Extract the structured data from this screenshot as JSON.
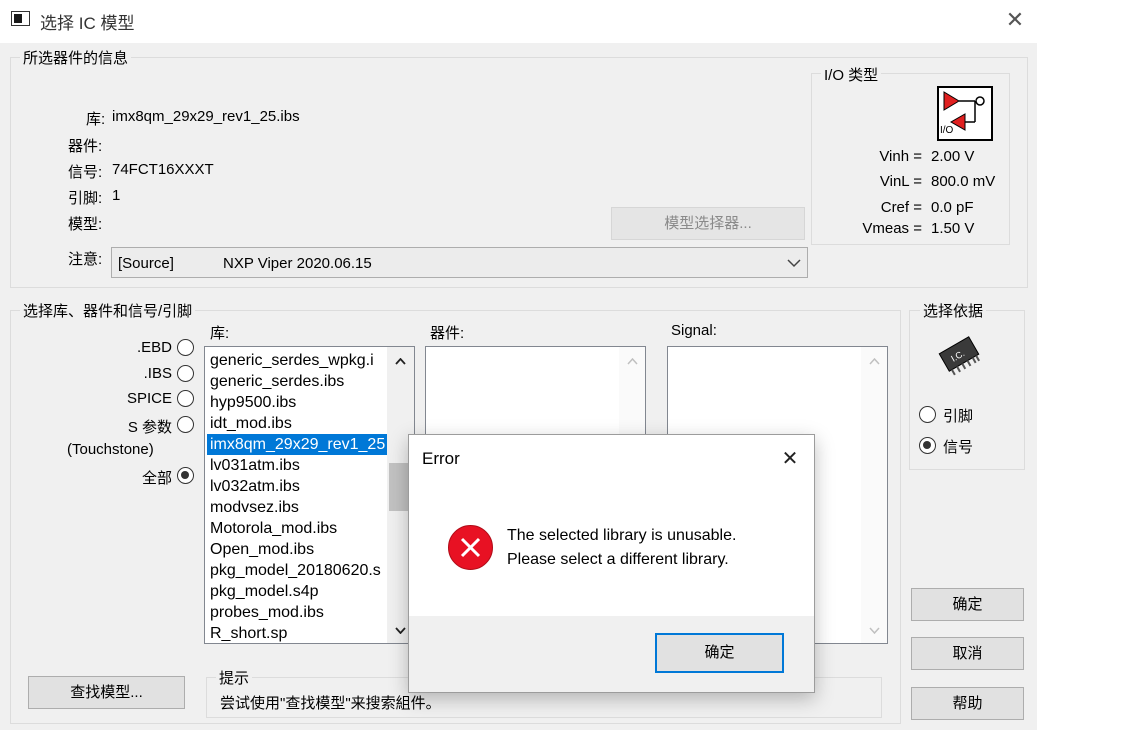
{
  "window": {
    "title": "选择 IC 模型",
    "close_glyph": "✕"
  },
  "selected_info": {
    "legend": "所选器件的信息",
    "library_label": "库:",
    "library_value": "imx8qm_29x29_rev1_25.ibs",
    "device_label": "器件:",
    "device_value": "",
    "signal_label": "信号:",
    "signal_value": "74FCT16XXXT",
    "pin_label": "引脚:",
    "pin_value": "1",
    "model_label": "模型:",
    "model_value": "",
    "model_selector_button": "模型选择器...",
    "note_label": "注意:",
    "note_source": "[Source]",
    "note_value": "NXP Viper 2020.06.15"
  },
  "io_type": {
    "legend": "I/O 类型",
    "icon_text": "I/O",
    "vinh_label": "Vinh =",
    "vinh_value": "2.00 V",
    "vinl_label": "VinL =",
    "vinl_value": "800.0 mV",
    "cref_label": "Cref =",
    "cref_value": "0.0 pF",
    "vmeas_label": "Vmeas =",
    "vmeas_value": "1.50 V"
  },
  "select_lib": {
    "legend": "选择库、器件和信号/引脚",
    "radios": [
      {
        "label": ".EBD",
        "checked": false
      },
      {
        "label": ".IBS",
        "checked": false
      },
      {
        "label": "SPICE",
        "checked": false
      },
      {
        "label": "S 参数",
        "checked": false
      },
      {
        "label": "全部",
        "checked": true
      }
    ],
    "touchstone_label": "(Touchstone)",
    "library_header": "库:",
    "device_header": "器件:",
    "signal_header": "Signal:",
    "library_items": [
      "generic_serdes_wpkg.i",
      "generic_serdes.ibs",
      "hyp9500.ibs",
      "idt_mod.ibs",
      "imx8qm_29x29_rev1_25",
      "lv031atm.ibs",
      "lv032atm.ibs",
      "modvsez.ibs",
      "Motorola_mod.ibs",
      "Open_mod.ibs",
      "pkg_model_20180620.s",
      "pkg_model.s4p",
      "probes_mod.ibs",
      "R_short.sp"
    ],
    "selected_index": 4,
    "find_model_button": "查找模型...",
    "hint_legend": "提示",
    "hint_text": "尝试使用\"查找模型\"来搜索組件。"
  },
  "select_by": {
    "legend": "选择依据",
    "chip_text": "I.C.",
    "pin_label": "引脚",
    "signal_label": "信号",
    "selected": "信号"
  },
  "buttons": {
    "ok": "确定",
    "cancel": "取消",
    "help": "帮助"
  },
  "error_dialog": {
    "title": "Error",
    "close_glyph": "✕",
    "line1": "The selected library is unusable.",
    "line2": "Please select a different library.",
    "ok": "确定"
  }
}
